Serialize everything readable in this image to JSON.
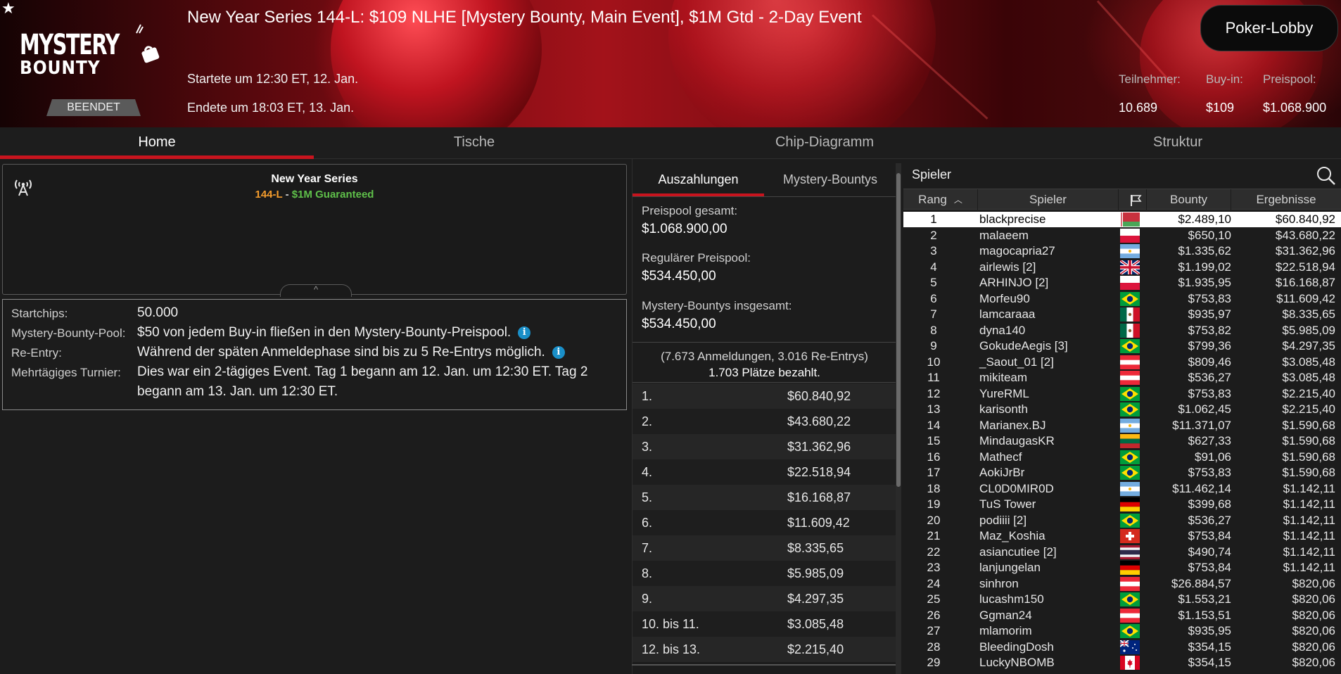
{
  "header": {
    "title": "New Year Series 144-L: $109 NLHE [Mystery Bounty, Main Event], $1M Gtd - 2-Day Event",
    "logo_line1": "MYSTERY",
    "logo_line2": "BOUNTY",
    "status": "BEENDET",
    "started": "Startete um 12:30 ET, 12. Jan.",
    "ended": "Endete um 18:03 ET, 13. Jan.",
    "lobby_button": "Poker-Lobby",
    "stats": {
      "participants_label": "Teilnehmer:",
      "participants_value": "10.689",
      "buyin_label": "Buy-in:",
      "buyin_value": "$109",
      "prizepool_label": "Preispool:",
      "prizepool_value": "$1.068.900"
    }
  },
  "tabs": [
    "Home",
    "Tische",
    "Chip-Diagramm",
    "Struktur"
  ],
  "info_card": {
    "series": "New Year Series",
    "code": "144-L",
    "separator": " - ",
    "guarantee": "$1M Guaranteed",
    "collapse_glyph": "^"
  },
  "details": [
    {
      "label": "Startchips:",
      "value": "50.000"
    },
    {
      "label": "Mystery-Bounty-Pool:",
      "value": "$50 von jedem Buy-in fließen in den Mystery-Bounty-Preispool."
    },
    {
      "label": "Re-Entry:",
      "value": "Während der späten Anmeldephase sind bis zu 5 Re-Entrys möglich."
    },
    {
      "label": "Mehrtägiges Turnier:",
      "value": "Dies war ein 2-tägiges Event. Tag 1 begann am 12. Jan. um 12:30 ET. Tag 2 begann am 13. Jan. um 12:30 ET."
    }
  ],
  "payouts": {
    "tabs": [
      "Auszahlungen",
      "Mystery-Bountys"
    ],
    "total_label": "Preispool gesamt:",
    "total_value": "$1.068.900,00",
    "regular_label": "Regulärer Preispool:",
    "regular_value": "$534.450,00",
    "mystery_label": "Mystery-Bountys insgesamt:",
    "mystery_value": "$534.450,00",
    "entries_line": "(7.673 Anmeldungen, 3.016 Re-Entrys)",
    "paid_line": "1.703 Plätze bezahlt.",
    "rows": [
      {
        "place": "1.",
        "amount": "$60.840,92"
      },
      {
        "place": "2.",
        "amount": "$43.680,22"
      },
      {
        "place": "3.",
        "amount": "$31.362,96"
      },
      {
        "place": "4.",
        "amount": "$22.518,94"
      },
      {
        "place": "5.",
        "amount": "$16.168,87"
      },
      {
        "place": "6.",
        "amount": "$11.609,42"
      },
      {
        "place": "7.",
        "amount": "$8.335,65"
      },
      {
        "place": "8.",
        "amount": "$5.985,09"
      },
      {
        "place": "9.",
        "amount": "$4.297,35"
      },
      {
        "place": "10. bis 11.",
        "amount": "$3.085,48"
      },
      {
        "place": "12. bis 13.",
        "amount": "$2.215,40"
      }
    ]
  },
  "players": {
    "title": "Spieler",
    "columns": {
      "rank": "Rang",
      "player": "Spieler",
      "bounty": "Bounty",
      "result": "Ergebnisse"
    },
    "rows": [
      {
        "rank": "1",
        "name": "blackprecise",
        "flag": "belarus",
        "bounty": "$2.489,10",
        "result": "$60.840,92"
      },
      {
        "rank": "2",
        "name": "malaeem",
        "flag": "red-white",
        "bounty": "$650,10",
        "result": "$43.680,22"
      },
      {
        "rank": "3",
        "name": "magocapria27",
        "flag": "argentina",
        "bounty": "$1.335,62",
        "result": "$31.362,96"
      },
      {
        "rank": "4",
        "name": "airlewis [2]",
        "flag": "uk",
        "bounty": "$1.199,02",
        "result": "$22.518,94"
      },
      {
        "rank": "5",
        "name": "ARHINJO [2]",
        "flag": "red-white",
        "bounty": "$1.935,95",
        "result": "$16.168,87"
      },
      {
        "rank": "6",
        "name": "Morfeu90",
        "flag": "brazil",
        "bounty": "$753,83",
        "result": "$11.609,42"
      },
      {
        "rank": "7",
        "name": "lamcaraaa",
        "flag": "mexico",
        "bounty": "$935,97",
        "result": "$8.335,65"
      },
      {
        "rank": "8",
        "name": "dyna140",
        "flag": "mexico",
        "bounty": "$753,82",
        "result": "$5.985,09"
      },
      {
        "rank": "9",
        "name": "GokudeAegis [3]",
        "flag": "brazil",
        "bounty": "$799,36",
        "result": "$4.297,35"
      },
      {
        "rank": "10",
        "name": "_Saout_01 [2]",
        "flag": "austria",
        "bounty": "$809,46",
        "result": "$3.085,48"
      },
      {
        "rank": "11",
        "name": "mikiteam",
        "flag": "austria",
        "bounty": "$536,27",
        "result": "$3.085,48"
      },
      {
        "rank": "12",
        "name": "YureRML",
        "flag": "brazil",
        "bounty": "$753,83",
        "result": "$2.215,40"
      },
      {
        "rank": "13",
        "name": "karisonth",
        "flag": "brazil",
        "bounty": "$1.062,45",
        "result": "$2.215,40"
      },
      {
        "rank": "14",
        "name": "Marianex.BJ",
        "flag": "argentina",
        "bounty": "$11.371,07",
        "result": "$1.590,68"
      },
      {
        "rank": "15",
        "name": "MindaugasKR",
        "flag": "lithuania",
        "bounty": "$627,33",
        "result": "$1.590,68"
      },
      {
        "rank": "16",
        "name": "Mathecf",
        "flag": "brazil",
        "bounty": "$91,06",
        "result": "$1.590,68"
      },
      {
        "rank": "17",
        "name": "AokiJrBr",
        "flag": "brazil",
        "bounty": "$753,83",
        "result": "$1.590,68"
      },
      {
        "rank": "18",
        "name": "CL0D0MIR0D",
        "flag": "argentina",
        "bounty": "$11.462,14",
        "result": "$1.142,11"
      },
      {
        "rank": "19",
        "name": "TuS Tower",
        "flag": "germany",
        "bounty": "$399,68",
        "result": "$1.142,11"
      },
      {
        "rank": "20",
        "name": "podiiii [2]",
        "flag": "brazil",
        "bounty": "$536,27",
        "result": "$1.142,11"
      },
      {
        "rank": "21",
        "name": "Maz_Koshia",
        "flag": "switzerland",
        "bounty": "$753,84",
        "result": "$1.142,11"
      },
      {
        "rank": "22",
        "name": "asiancutiee [2]",
        "flag": "thailand",
        "bounty": "$490,74",
        "result": "$1.142,11"
      },
      {
        "rank": "23",
        "name": "lanjungelan",
        "flag": "germany",
        "bounty": "$753,84",
        "result": "$1.142,11"
      },
      {
        "rank": "24",
        "name": "sinhron",
        "flag": "austria",
        "bounty": "$26.884,57",
        "result": "$820,06"
      },
      {
        "rank": "25",
        "name": "lucashm150",
        "flag": "brazil",
        "bounty": "$1.553,21",
        "result": "$820,06"
      },
      {
        "rank": "26",
        "name": "Ggman24",
        "flag": "austria",
        "bounty": "$1.153,51",
        "result": "$820,06"
      },
      {
        "rank": "27",
        "name": "mlamorim",
        "flag": "brazil",
        "bounty": "$935,95",
        "result": "$820,06"
      },
      {
        "rank": "28",
        "name": "BleedingDosh",
        "flag": "australia",
        "bounty": "$354,15",
        "result": "$820,06"
      },
      {
        "rank": "29",
        "name": "LuckyNBOMB",
        "flag": "canada",
        "bounty": "$354,15",
        "result": "$820,06"
      }
    ]
  },
  "colors": {
    "accent_red": "#c8141e",
    "series_code": "#f39b2c",
    "guarantee_green": "#5fc04a",
    "info_blue": "#1a8fc8"
  },
  "icons": [
    "star-icon",
    "antenna-icon",
    "info-icon",
    "search-icon",
    "flag-header-icon",
    "sort-asc-icon"
  ]
}
